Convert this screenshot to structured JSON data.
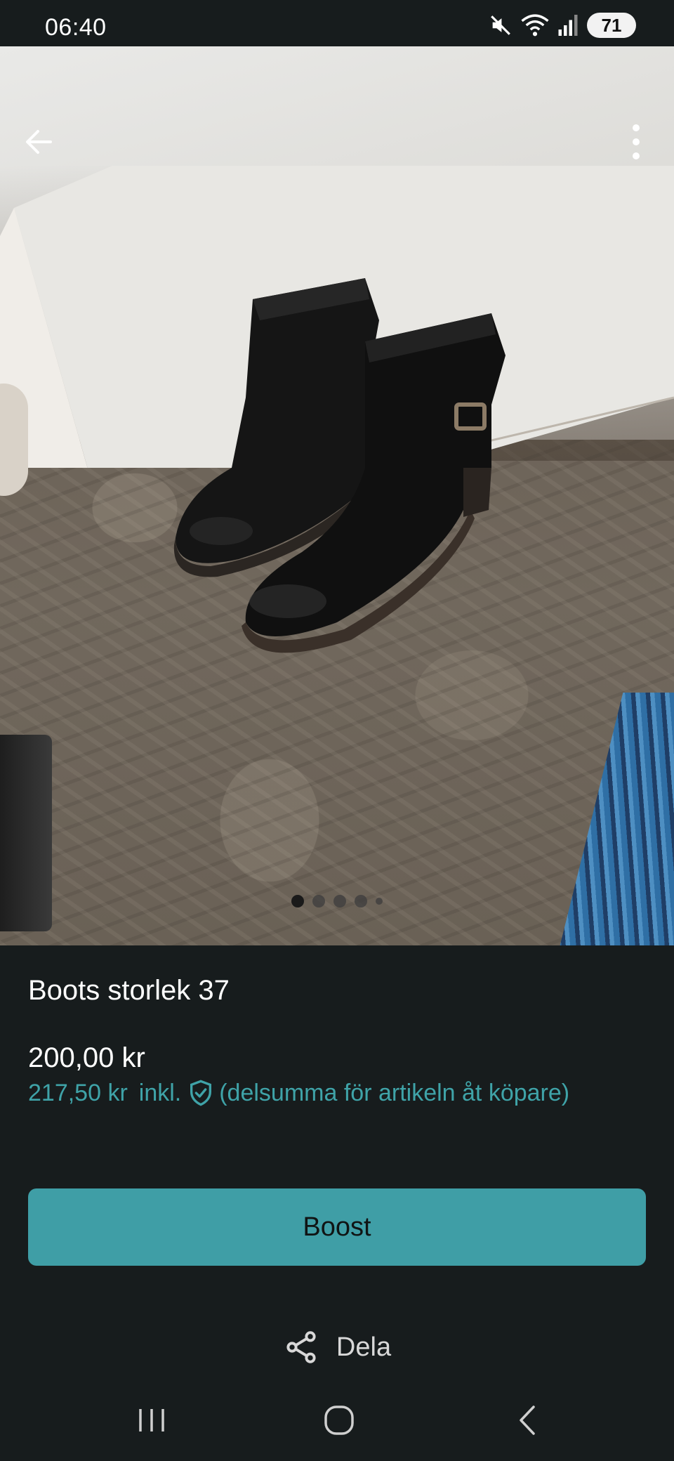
{
  "status_bar": {
    "time": "06:40",
    "battery": "71",
    "icons": [
      "mute-icon",
      "wifi-icon",
      "signal-icon",
      "battery-icon"
    ]
  },
  "photo": {
    "pager_total": 5,
    "pager_active": 0
  },
  "listing": {
    "title": "Boots storlek 37",
    "price": "200,00 kr",
    "buyer_price": "217,50 kr",
    "buyer_incl": "inkl.",
    "buyer_note": "(delsumma för artikeln åt köpare)"
  },
  "actions": {
    "boost_label": "Boost",
    "share_label": "Dela"
  },
  "colors": {
    "background": "#171c1d",
    "accent": "#3f9ea6",
    "accent_text": "#3fa3a8"
  }
}
